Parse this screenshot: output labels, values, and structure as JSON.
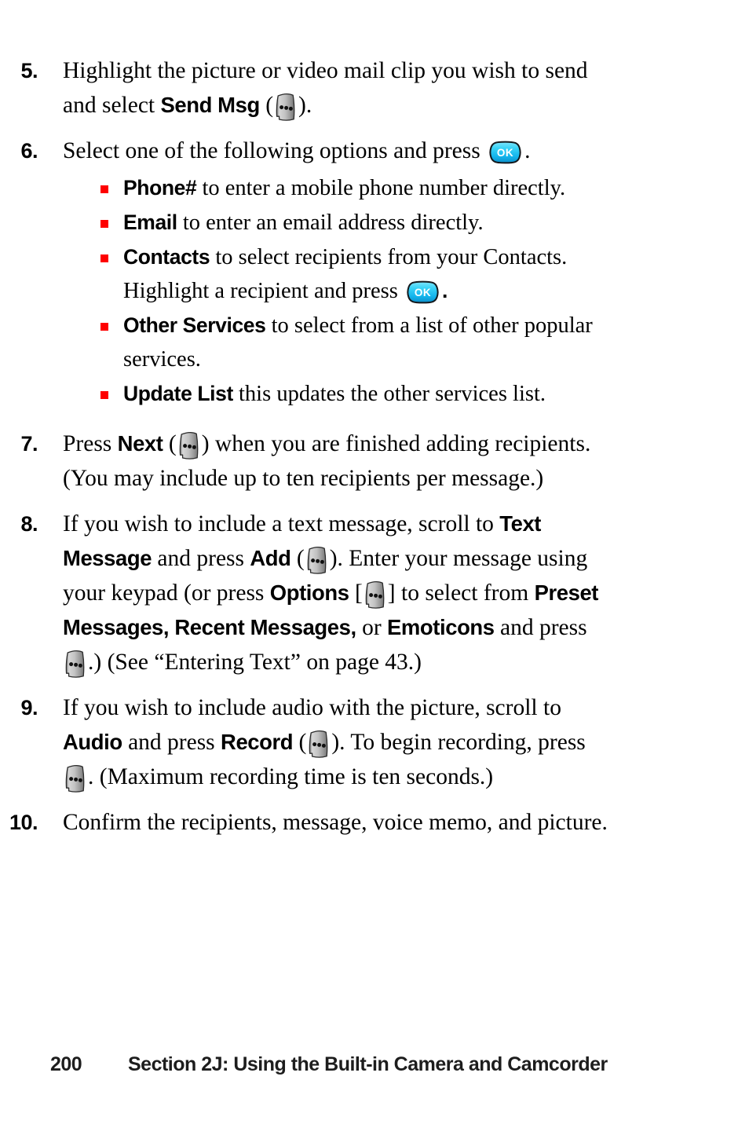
{
  "page": {
    "number": "200",
    "section": "Section 2J: Using the Built-in Camera and Camcorder"
  },
  "icons": {
    "softkey": "softkey-icon",
    "ok_key": "ok-key-icon",
    "ok_label": "OK",
    "bullet": "red-square-bullet"
  },
  "colors": {
    "bullet_red": "#fe0000",
    "ok_key_cyan": "#35d2f5",
    "ok_key_blue": "#0aa7e0",
    "softkey_gray": "#b4b4b4",
    "text": "#000000",
    "footer_text": "#1d1d1d"
  },
  "steps": [
    {
      "number": "5.",
      "parts": [
        {
          "t": "text",
          "v": "Highlight the picture or video mail clip you wish to send and select "
        },
        {
          "t": "ui",
          "v": "Send Msg"
        },
        {
          "t": "text",
          "v": " ("
        },
        {
          "t": "softkey"
        },
        {
          "t": "text",
          "v": ")."
        }
      ]
    },
    {
      "number": "6.",
      "parts": [
        {
          "t": "text",
          "v": "Select one of the following options and press "
        },
        {
          "t": "okkey"
        },
        {
          "t": "text",
          "v": "."
        }
      ],
      "bullets": [
        {
          "parts": [
            {
              "t": "ui",
              "v": "Phone#"
            },
            {
              "t": "text",
              "v": " to enter a mobile phone number directly."
            }
          ]
        },
        {
          "parts": [
            {
              "t": "ui",
              "v": "Email"
            },
            {
              "t": "text",
              "v": " to enter an email address directly."
            }
          ]
        },
        {
          "parts": [
            {
              "t": "ui",
              "v": "Contacts"
            },
            {
              "t": "text",
              "v": " to select recipients from your Contacts. Highlight a recipient and press "
            },
            {
              "t": "okkey"
            },
            {
              "t": "ui",
              "v": "."
            }
          ]
        },
        {
          "parts": [
            {
              "t": "ui",
              "v": "Other Services"
            },
            {
              "t": "text",
              "v": " to select from a list of other popular services."
            }
          ]
        },
        {
          "parts": [
            {
              "t": "ui",
              "v": "Update List"
            },
            {
              "t": "text",
              "v": " this updates the other services list."
            }
          ]
        }
      ]
    },
    {
      "number": "7.",
      "parts": [
        {
          "t": "text",
          "v": "Press "
        },
        {
          "t": "ui",
          "v": "Next"
        },
        {
          "t": "text",
          "v": " ("
        },
        {
          "t": "softkey"
        },
        {
          "t": "text",
          "v": ") when you are finished adding recipients. (You may include up to ten recipients per message.)"
        }
      ]
    },
    {
      "number": "8.",
      "parts": [
        {
          "t": "text",
          "v": "If you wish to include a text message, scroll to "
        },
        {
          "t": "ui",
          "v": "Text Message"
        },
        {
          "t": "text",
          "v": " and press "
        },
        {
          "t": "ui",
          "v": "Add"
        },
        {
          "t": "text",
          "v": " ("
        },
        {
          "t": "softkey"
        },
        {
          "t": "text",
          "v": "). Enter your message using your keypad (or press "
        },
        {
          "t": "ui",
          "v": "Options"
        },
        {
          "t": "text",
          "v": " ["
        },
        {
          "t": "softkey"
        },
        {
          "t": "text",
          "v": "] to select from "
        },
        {
          "t": "ui",
          "v": "Preset Messages, Recent Messages,"
        },
        {
          "t": "text",
          "v": " or "
        },
        {
          "t": "ui",
          "v": "Emoticons"
        },
        {
          "t": "text",
          "v": " and press "
        },
        {
          "t": "softkey"
        },
        {
          "t": "text",
          "v": ".) (See “Entering Text” on page 43.)"
        }
      ]
    },
    {
      "number": "9.",
      "parts": [
        {
          "t": "text",
          "v": "If you wish to include audio with the picture, scroll to "
        },
        {
          "t": "ui",
          "v": "Audio"
        },
        {
          "t": "text",
          "v": " and press "
        },
        {
          "t": "ui",
          "v": "Record"
        },
        {
          "t": "text",
          "v": " ("
        },
        {
          "t": "softkey"
        },
        {
          "t": "text",
          "v": "). To begin recording, press "
        },
        {
          "t": "softkey"
        },
        {
          "t": "text",
          "v": ". (Maximum recording time is ten seconds.)"
        }
      ]
    },
    {
      "number": "10.",
      "parts": [
        {
          "t": "text",
          "v": "Confirm the recipients, message, voice memo, and picture."
        }
      ]
    }
  ]
}
